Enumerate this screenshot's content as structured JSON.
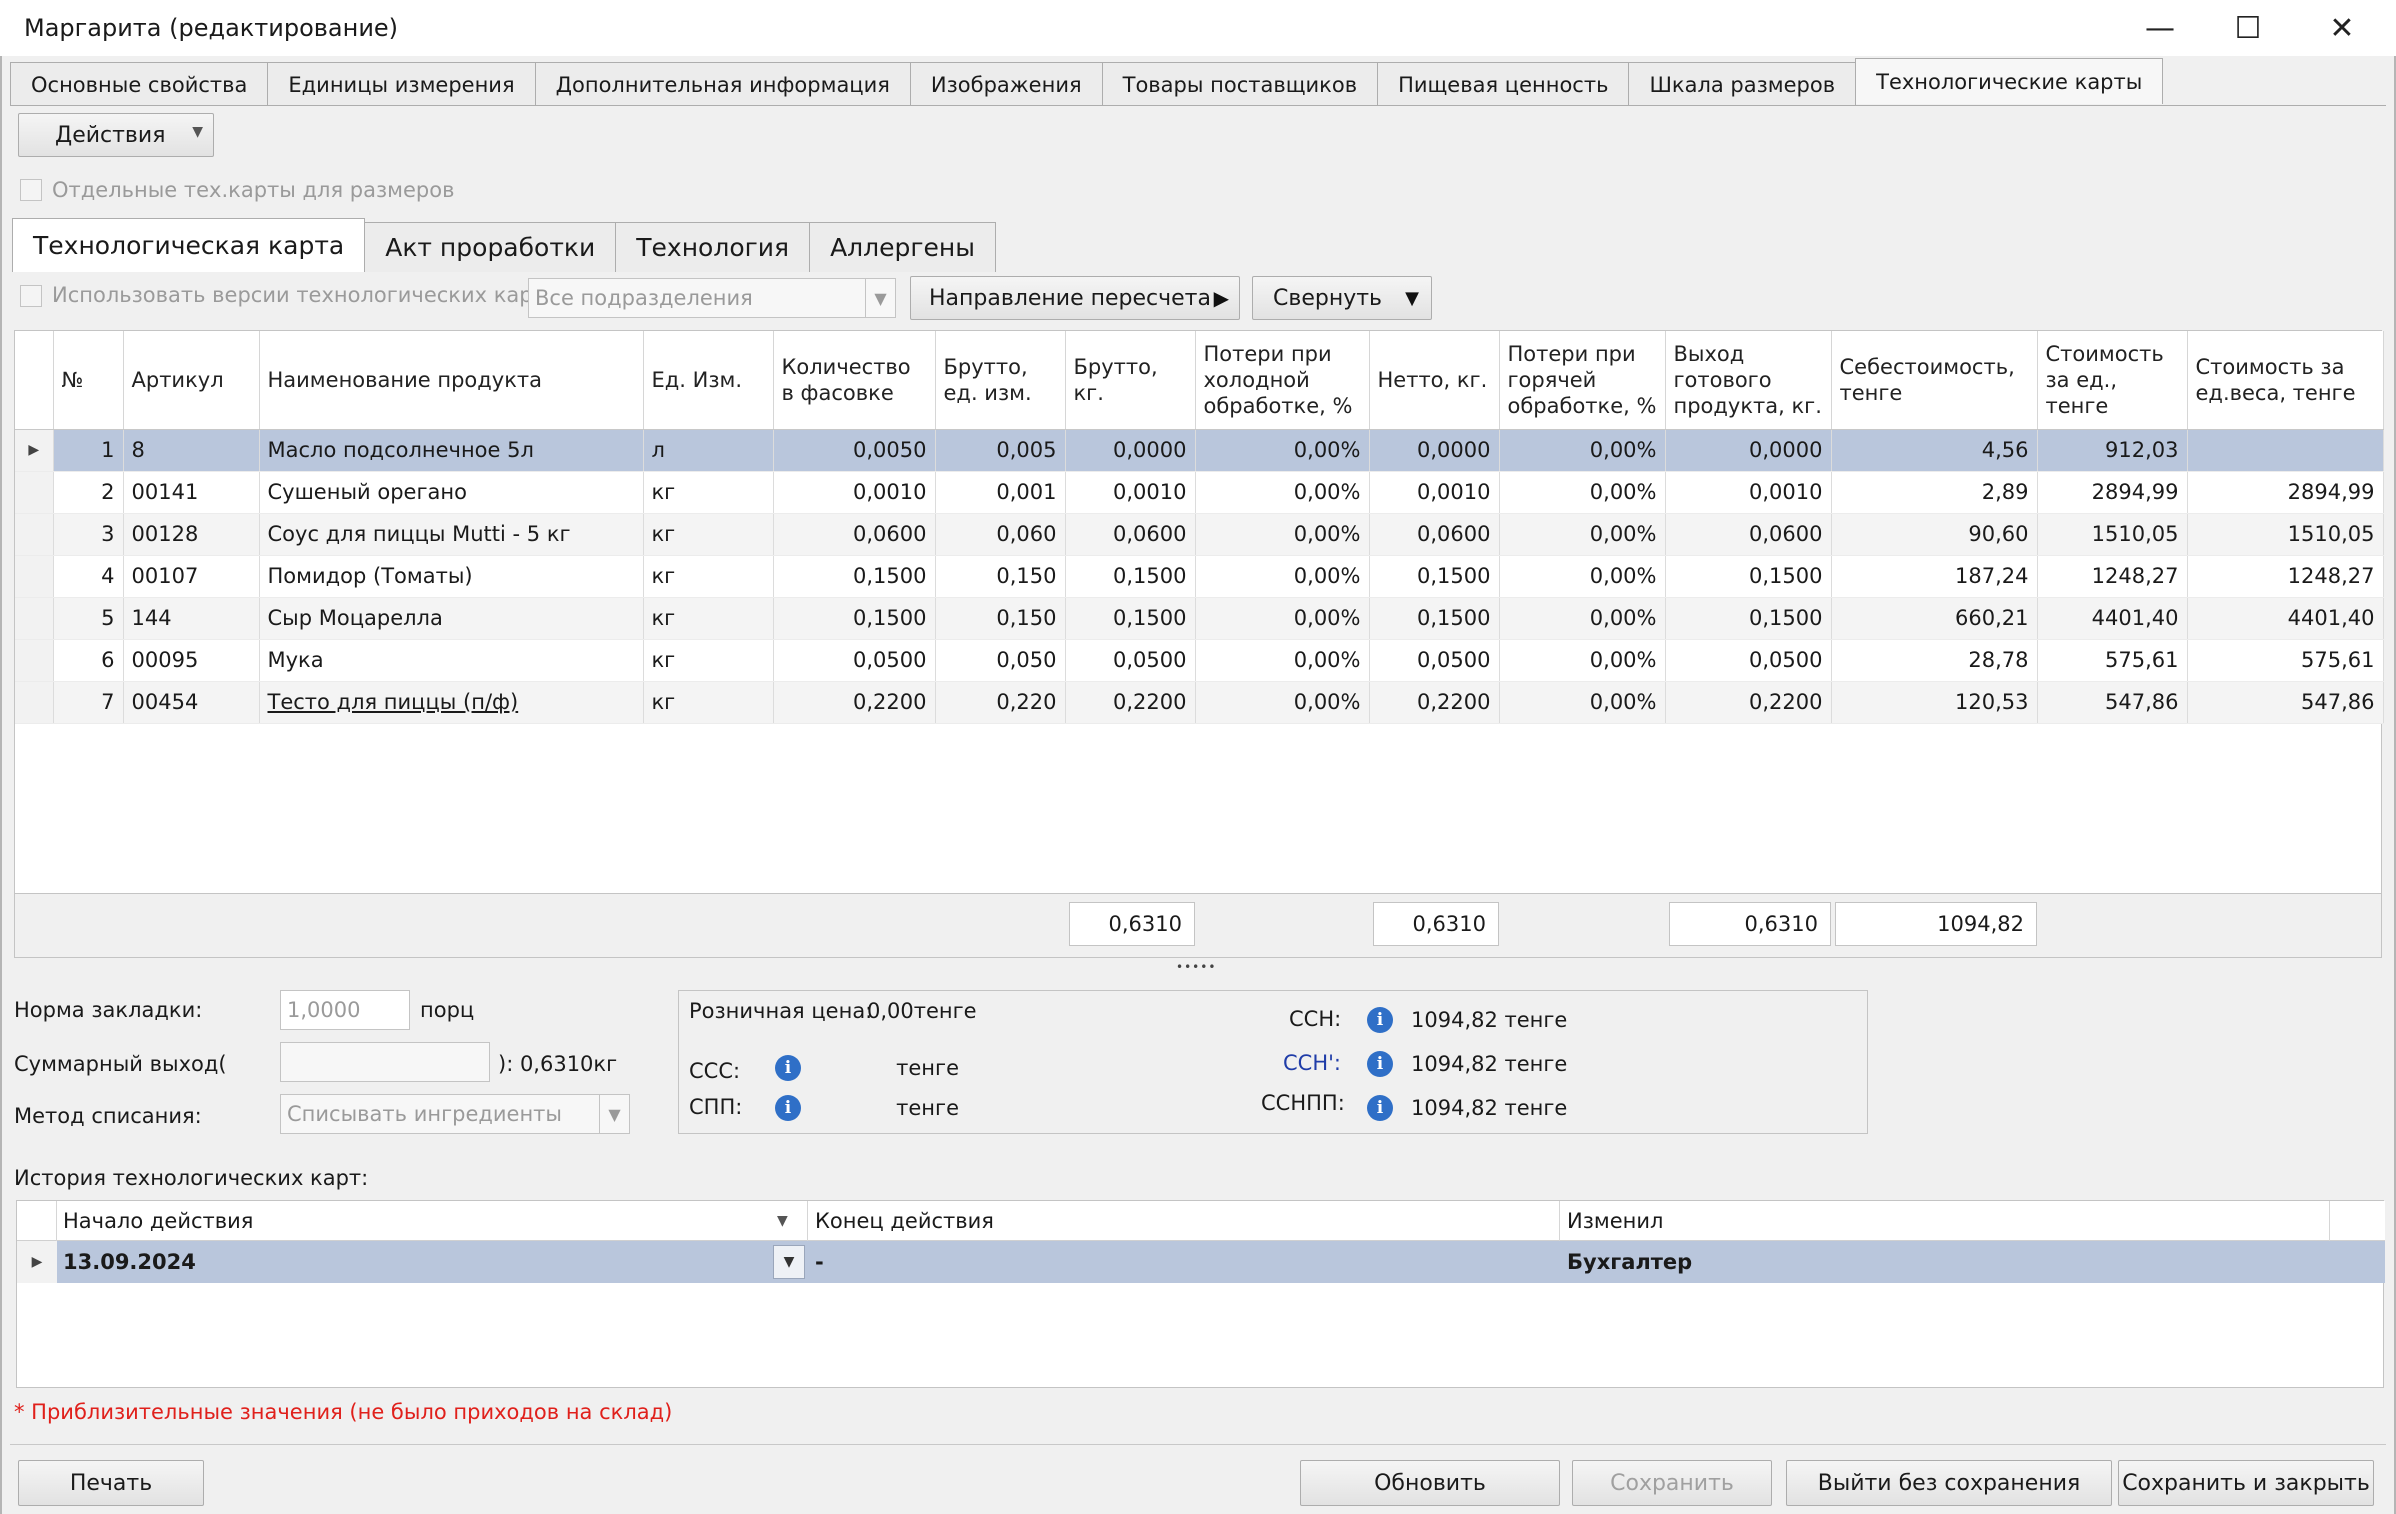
{
  "window": {
    "title": "Маргарита (редактирование)",
    "minimize": "—",
    "maximize": "☐",
    "close": "✕"
  },
  "top_tabs": [
    "Основные свойства",
    "Единицы измерения",
    "Дополнительная информация",
    "Изображения",
    "Товары поставщиков",
    "Пищевая ценность",
    "Шкала размеров",
    "Технологические карты"
  ],
  "actions_button": "Действия",
  "separate_cards_checkbox": "Отдельные тех.карты для размеров",
  "inner_tabs": [
    "Технологическая карта",
    "Акт проработки",
    "Технология",
    "Аллергены"
  ],
  "use_versions_checkbox": "Использовать версии технологических карт",
  "department_select": "Все подразделения",
  "recalc_direction_button": "Направление пересчета",
  "collapse_button": "Свернуть",
  "grid": {
    "headers": [
      "№",
      "Артикул",
      "Наименование продукта",
      "Ед. Изм.",
      "Количество в фасовке",
      "Брутто, ед. изм.",
      "Брутто, кг.",
      "Потери при холодной обработке, %",
      "Нетто, кг.",
      "Потери при горячей обработке, %",
      "Выход готового продукта, кг.",
      "Себестоимость, тенге",
      "Стоимость за ед., тенге",
      "Стоимость за ед.веса, тенге"
    ],
    "rows": [
      [
        "1",
        "8",
        "Масло подсолнечное 5л",
        "л",
        "0,0050",
        "0,005",
        "0,0000",
        "0,00%",
        "0,0000",
        "0,00%",
        "0,0000",
        "4,56",
        "912,03",
        ""
      ],
      [
        "2",
        "00141",
        "Сушеный орегано",
        "кг",
        "0,0010",
        "0,001",
        "0,0010",
        "0,00%",
        "0,0010",
        "0,00%",
        "0,0010",
        "2,89",
        "2894,99",
        "2894,99"
      ],
      [
        "3",
        "00128",
        "Соус для пиццы Mutti - 5 кг",
        "кг",
        "0,0600",
        "0,060",
        "0,0600",
        "0,00%",
        "0,0600",
        "0,00%",
        "0,0600",
        "90,60",
        "1510,05",
        "1510,05"
      ],
      [
        "4",
        "00107",
        "Помидор (Томаты)",
        "кг",
        "0,1500",
        "0,150",
        "0,1500",
        "0,00%",
        "0,1500",
        "0,00%",
        "0,1500",
        "187,24",
        "1248,27",
        "1248,27"
      ],
      [
        "5",
        "144",
        "Сыр Моцарелла",
        "кг",
        "0,1500",
        "0,150",
        "0,1500",
        "0,00%",
        "0,1500",
        "0,00%",
        "0,1500",
        "660,21",
        "4401,40",
        "4401,40"
      ],
      [
        "6",
        "00095",
        "Мука",
        "кг",
        "0,0500",
        "0,050",
        "0,0500",
        "0,00%",
        "0,0500",
        "0,00%",
        "0,0500",
        "28,78",
        "575,61",
        "575,61"
      ],
      [
        "7",
        "00454",
        "Тесто для пиццы (п/ф)",
        "кг",
        "0,2200",
        "0,220",
        "0,2200",
        "0,00%",
        "0,2200",
        "0,00%",
        "0,2200",
        "120,53",
        "547,86",
        "547,86"
      ]
    ],
    "totals": {
      "brutto_kg": "0,6310",
      "netto_kg": "0,6310",
      "output_kg": "0,6310",
      "cost": "1094,82"
    }
  },
  "splitter": "•••••",
  "form": {
    "norm_label": "Норма закладки:",
    "norm_value": "1,0000",
    "norm_unit": "порц",
    "sum_output_label": "Суммарный выход(",
    "sum_output_suffix": "): 0,6310кг",
    "method_label": "Метод списания:",
    "method_value": "Списывать ингредиенты"
  },
  "prices": {
    "retail_label": "Розничная цена:",
    "retail_value": "0,00тенге",
    "ccc_label": "ССС:",
    "ccc_value": "тенге",
    "spp_label": "СПП:",
    "spp_value": "тенге",
    "ssn_label": "ССН:",
    "ssn_value": "1094,82 тенге",
    "ssn2_label": "ССН':",
    "ssn2_value": "1094,82 тенге",
    "ssnpp_label": "ССНПП:",
    "ssnpp_value": "1094,82 тенге"
  },
  "history": {
    "label": "История технологических карт:",
    "headers": [
      "Начало действия",
      "Конец действия",
      "Изменил"
    ],
    "row": [
      "13.09.2024",
      "-",
      "Бухгалтер"
    ]
  },
  "approx_note": "* Приблизительные значения (не было приходов на склад)",
  "footer": {
    "print": "Печать",
    "refresh": "Обновить",
    "save": "Сохранить",
    "exit": "Выйти без сохранения",
    "save_close": "Сохранить и закрыть"
  },
  "colors": {
    "selected_row": "#b9c6dc",
    "note_red": "#e0201b",
    "info_blue": "#2f6fc7",
    "ssn2_blue": "#1f3ca8"
  }
}
